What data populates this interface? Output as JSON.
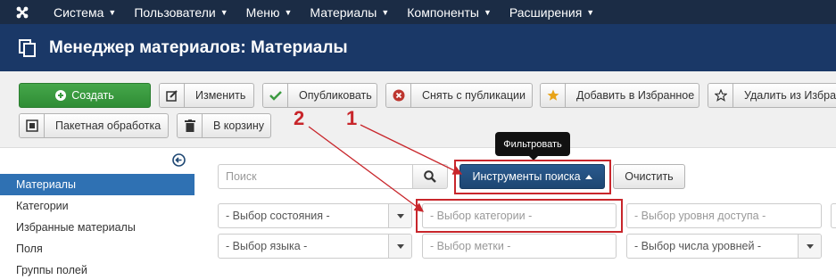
{
  "navbar": {
    "logo_icon": "joomla-logo-icon",
    "items": [
      {
        "label": "Система"
      },
      {
        "label": "Пользователи"
      },
      {
        "label": "Меню"
      },
      {
        "label": "Материалы"
      },
      {
        "label": "Компоненты"
      },
      {
        "label": "Расширения"
      }
    ]
  },
  "header": {
    "title": "Менеджер материалов: Материалы",
    "icon": "copy-icon"
  },
  "toolbar": {
    "create": "Создать",
    "edit": "Изменить",
    "publish": "Опубликовать",
    "unpublish": "Снять с публикации",
    "feature": "Добавить в Избранное",
    "unfeature": "Удалить из Избран",
    "batch": "Пакетная обработка",
    "trash": "В корзину"
  },
  "sidebar": {
    "items": [
      {
        "label": "Материалы",
        "active": true
      },
      {
        "label": "Категории"
      },
      {
        "label": "Избранные материалы"
      },
      {
        "label": "Поля"
      },
      {
        "label": "Группы полей"
      }
    ]
  },
  "filters": {
    "search_placeholder": "Поиск",
    "search_tools": "Инструменты поиска",
    "clear": "Очистить",
    "tooltip": "Фильтровать",
    "state": "- Выбор состояния -",
    "category": "- Выбор категории -",
    "access": "- Выбор уровня доступа -",
    "language": "- Выбор языка -",
    "tag": "- Выбор метки -",
    "levels": "- Выбор числа уровней -"
  },
  "annotations": {
    "marker_1": "1",
    "marker_2": "2"
  },
  "colors": {
    "navbar": "#1b2c45",
    "header": "#1a3867",
    "success": "#3c9a41",
    "primary": "#1d4672",
    "sidebar_active": "#2f71b3",
    "annotation": "#c8262b"
  }
}
